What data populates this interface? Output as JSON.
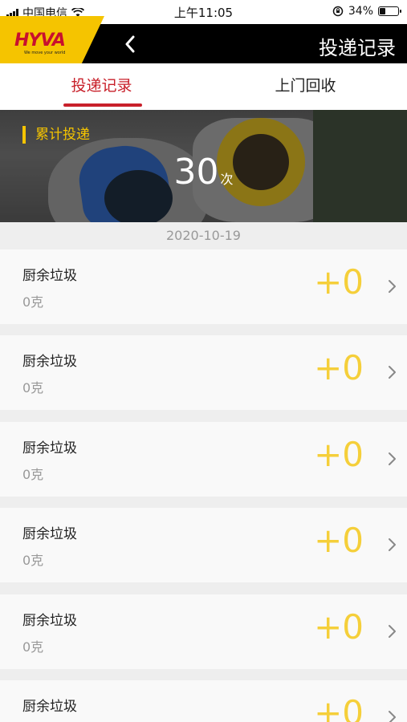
{
  "status_bar": {
    "carrier": "中国电信",
    "time": "上午11:05",
    "battery": "34%",
    "battery_level": 0.34
  },
  "header": {
    "logo_text": "HYVA",
    "logo_tagline": "We move your world",
    "title": "投递记录",
    "back_icon": "chevron-left-icon"
  },
  "tabs": [
    {
      "label": "投递记录",
      "active": true
    },
    {
      "label": "上门回收",
      "active": false
    }
  ],
  "summary": {
    "label": "累计投递",
    "count": "30",
    "unit": "次"
  },
  "date": "2020-10-19",
  "records": [
    {
      "name": "厨余垃圾",
      "weight": "0克",
      "points": "+0"
    },
    {
      "name": "厨余垃圾",
      "weight": "0克",
      "points": "+0"
    },
    {
      "name": "厨余垃圾",
      "weight": "0克",
      "points": "+0"
    },
    {
      "name": "厨余垃圾",
      "weight": "0克",
      "points": "+0"
    },
    {
      "name": "厨余垃圾",
      "weight": "0克",
      "points": "+0"
    },
    {
      "name": "厨余垃圾",
      "weight": "",
      "points": "+0"
    }
  ],
  "colors": {
    "accent_red": "#c8202a",
    "accent_yellow": "#f5c400",
    "points_yellow": "#f5cf3a"
  }
}
